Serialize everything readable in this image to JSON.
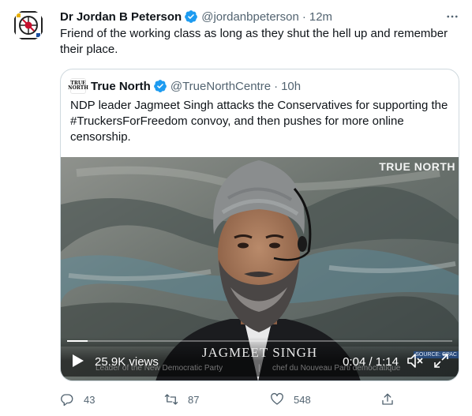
{
  "author": {
    "name": "Dr Jordan B Peterson",
    "handle": "@jordanbpeterson",
    "separator": "·",
    "time": "12m",
    "avatar_icon": "jordan-peterson-avatar"
  },
  "tweet": {
    "text": "Friend of the working class as long as they shut the hell up and remember their place."
  },
  "quote": {
    "author_name": "True North",
    "author_handle": "@TrueNorthCentre",
    "separator": "·",
    "time": "10h",
    "logo_text": "TRUE NORTH",
    "text": "NDP leader Jagmeet Singh attacks the Conservatives for supporting the #TruckersForFreedom convoy, and then pushes for more online censorship."
  },
  "video": {
    "watermark": "TRUE NORTH",
    "name_banner": "JAGMEET SINGH",
    "subtitle_left": "Leader of the New Democratic Party",
    "subtitle_divider": "|",
    "subtitle_right": "chef du Nouveau Parti démocratique",
    "source_tag": "SOURCE: CPAC",
    "views": "25.9K views",
    "timecode": "0:04 / 1:14",
    "progress_fraction": 0.054
  },
  "actions": {
    "reply_count": "43",
    "retweet_count": "87",
    "like_count": "548"
  },
  "colors": {
    "verified": "#1d9bf0",
    "secondary_text": "#536471",
    "border": "#cfd9de"
  }
}
